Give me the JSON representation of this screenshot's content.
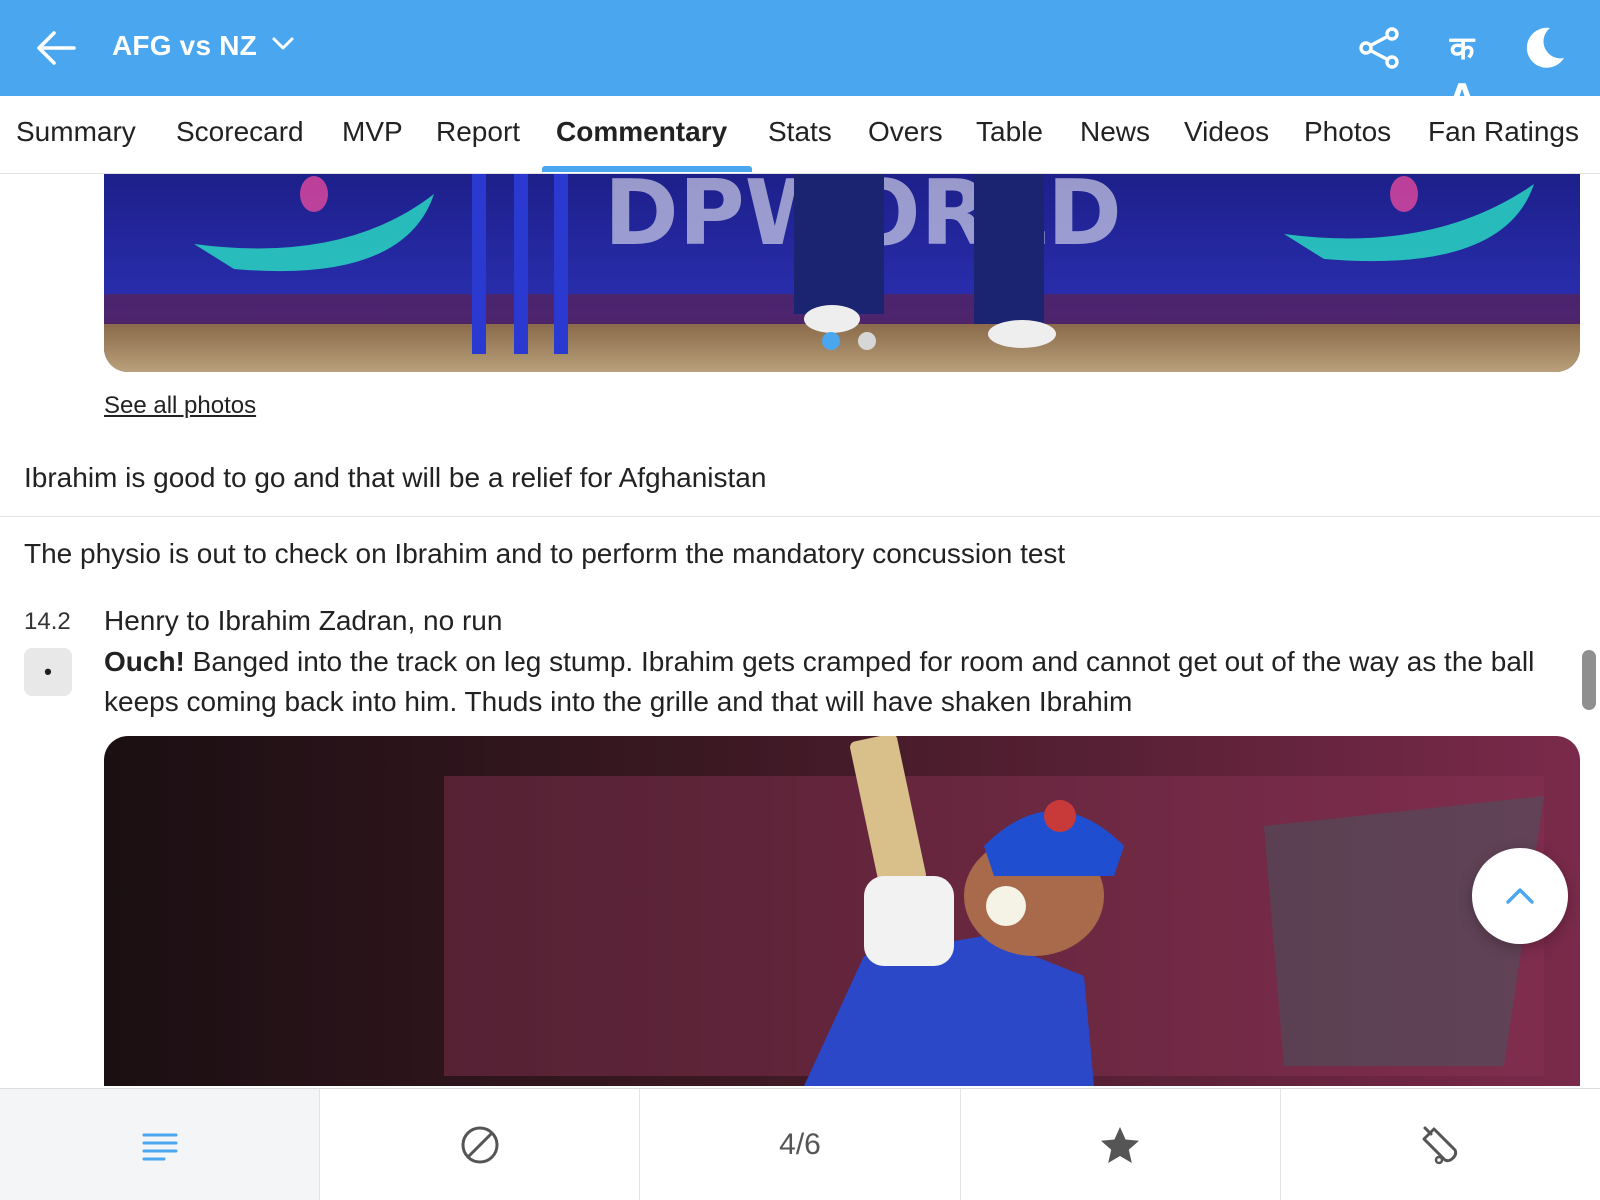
{
  "header": {
    "title": "AFG vs NZ",
    "background_color": "#4aa6ef",
    "icons": [
      "back-arrow-icon",
      "chevron-down-icon",
      "share-icon",
      "language-icon",
      "dark-mode-icon"
    ],
    "language_label": "क A"
  },
  "tabs": {
    "items": [
      "Summary",
      "Scorecard",
      "MVP",
      "Report",
      "Commentary",
      "Stats",
      "Overs",
      "Table",
      "News",
      "Videos",
      "Photos",
      "Fan Ratings"
    ],
    "active": "Commentary",
    "accent_color": "#4aa6ef"
  },
  "photos": {
    "see_all_label": "See all photos",
    "carousel_total": 2,
    "carousel_active": 1
  },
  "commentary": {
    "line_1": "Ibrahim is good to go and that will be a relief for Afghanistan",
    "line_2": "The physio is out to check on Ibrahim and to perform the mandatory concussion test",
    "ball": {
      "over": "14.2",
      "result_badge": "•",
      "title": "Henry to Ibrahim Zadran, no run",
      "highlight": "Ouch!",
      "description": "Banged into the track on leg stump. Ibrahim gets cramped for room and cannot get out of the way as the ball keeps coming back into him. Thuds into the grille and that will have shaken Ibrahim"
    }
  },
  "bottom_nav": {
    "items": [
      "menu-lines-icon",
      "cricket-ball-icon",
      "4/6",
      "star-icon",
      "cricket-bat-icon"
    ],
    "counter": "4/6",
    "active_index": 0
  }
}
